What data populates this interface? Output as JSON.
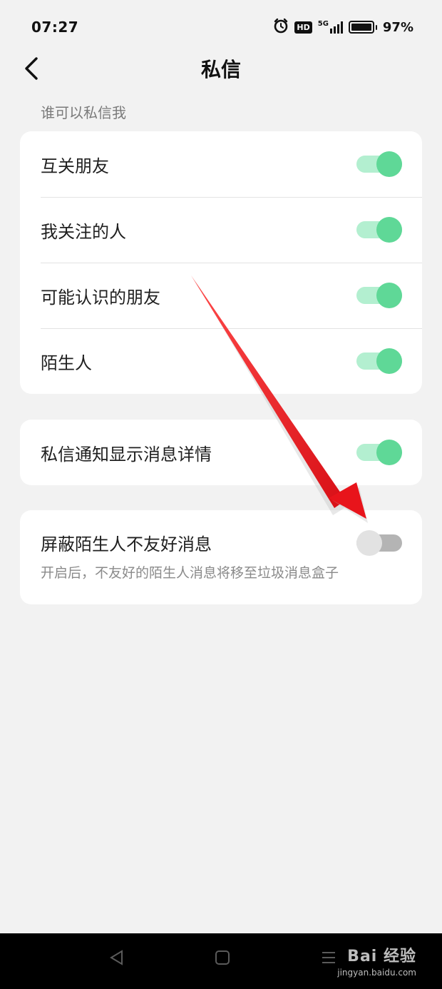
{
  "status_bar": {
    "time": "07:27",
    "hd_badge": "HD",
    "network": "5G",
    "battery": "97%",
    "icons": [
      "alarm-icon",
      "hd-icon",
      "5g-signal-icon",
      "battery-icon"
    ]
  },
  "header": {
    "title": "私信",
    "back_icon": "chevron-left-icon"
  },
  "section_label": "谁可以私信我",
  "who_can_message": [
    {
      "label": "互关朋友",
      "enabled": true
    },
    {
      "label": "我关注的人",
      "enabled": true
    },
    {
      "label": "可能认识的朋友",
      "enabled": true
    },
    {
      "label": "陌生人",
      "enabled": true
    }
  ],
  "notification_detail": {
    "label": "私信通知显示消息详情",
    "enabled": true
  },
  "block_unfriendly": {
    "label": "屏蔽陌生人不友好消息",
    "description": "开启后，不友好的陌生人消息将移至垃圾消息盒子",
    "enabled": false
  },
  "bottom_nav": {
    "icons": [
      "back-triangle-icon",
      "home-square-icon",
      "menu-icon"
    ]
  },
  "watermark": {
    "top": "Bai 经验",
    "bottom": "jingyan.baidu.com"
  },
  "colors": {
    "background": "#f2f2f2",
    "card": "#ffffff",
    "toggle_on_knob": "#5fd897",
    "toggle_on_track": "#b3efd0",
    "toggle_off_knob": "#e2e2e2",
    "toggle_off_track": "#b4b4b4",
    "arrow": "#e8141b"
  }
}
